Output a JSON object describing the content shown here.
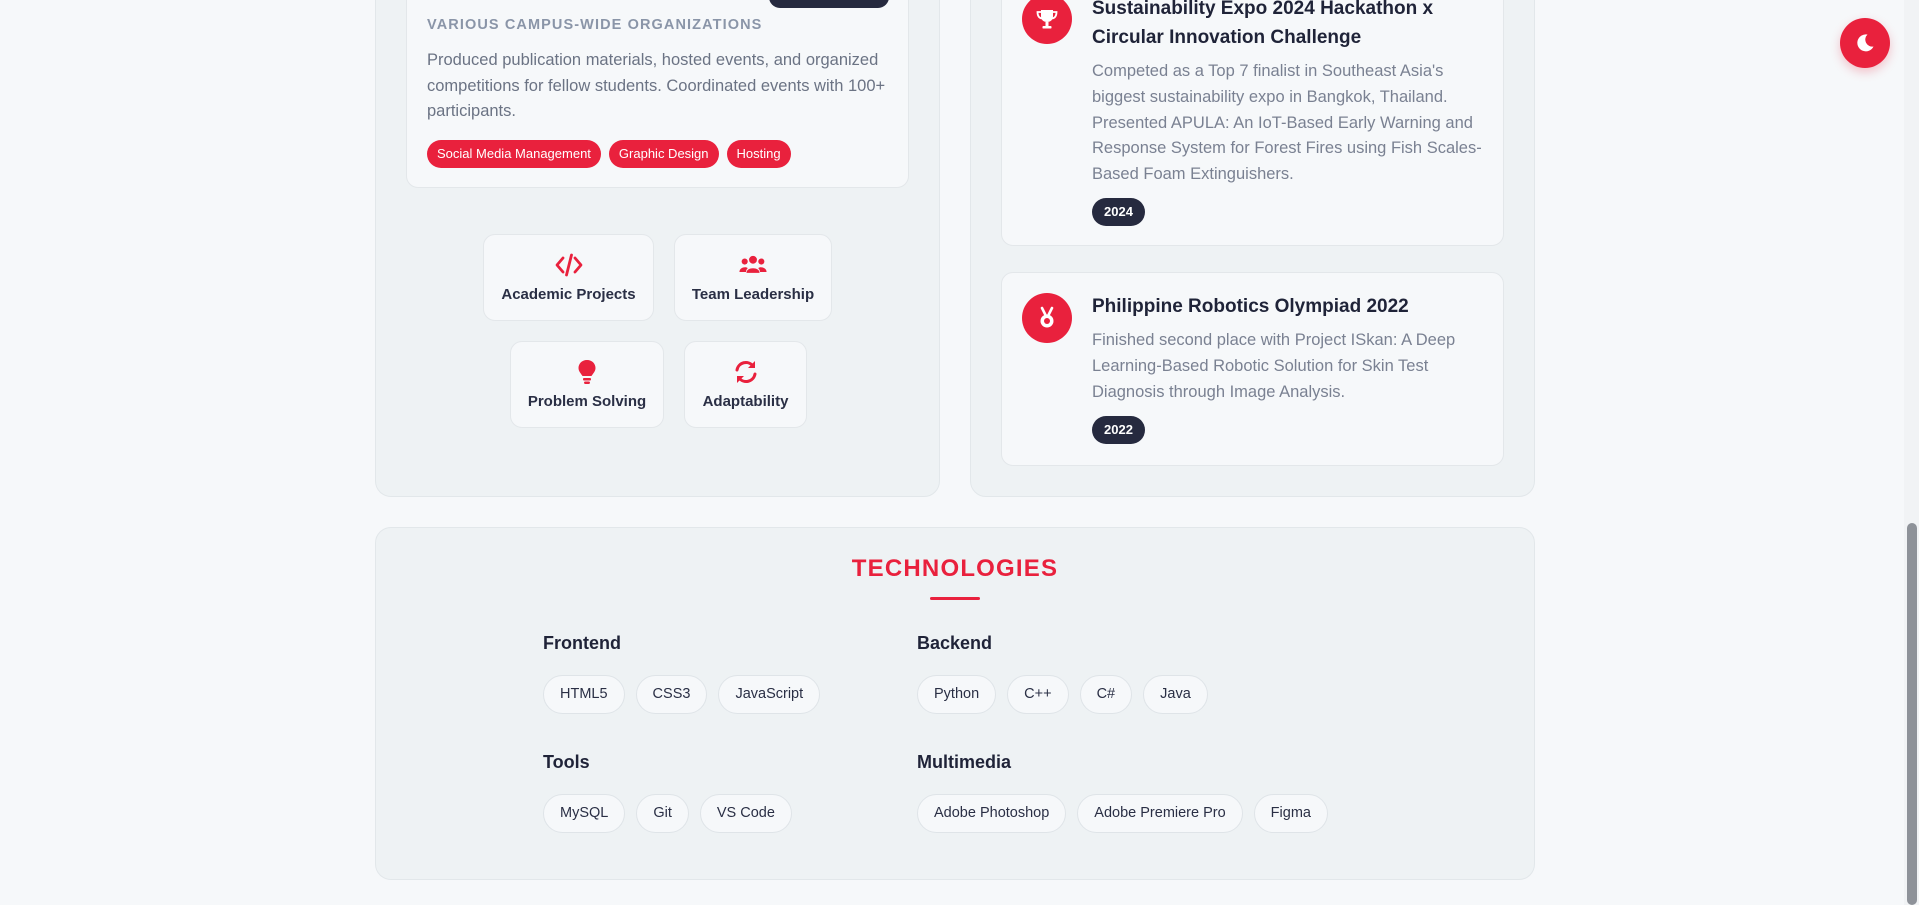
{
  "colors": {
    "accent": "#e9213d",
    "dark_badge": "#262a3f",
    "panel_bg": "#eef2f4"
  },
  "experience": {
    "org": "VARIOUS CAMPUS-WIDE ORGANIZATIONS",
    "description": "Produced publication materials, hosted events, and organized competitions for fellow students. Coordinated events with 100+ participants.",
    "tags": [
      "Social Media Management",
      "Graphic Design",
      "Hosting"
    ]
  },
  "skills": [
    {
      "label": "Academic Projects",
      "icon": "code-icon"
    },
    {
      "label": "Team Leadership",
      "icon": "users-icon"
    },
    {
      "label": "Problem Solving",
      "icon": "lightbulb-icon"
    },
    {
      "label": "Adaptability",
      "icon": "sync-icon"
    }
  ],
  "achievements": [
    {
      "title": "Sustainability Expo 2024 Hackathon x Circular Innovation Challenge",
      "description": "Competed as a Top 7 finalist in Southeast Asia's biggest sustainability expo in Bangkok, Thailand. Presented APULA: An IoT-Based Early Warning and Response System for Forest Fires using Fish Scales-Based Foam Extinguishers.",
      "year": "2024",
      "icon": "trophy-icon"
    },
    {
      "title": "Philippine Robotics Olympiad 2022",
      "description": "Finished second place with Project ISkan: A Deep Learning-Based Robotic Solution for Skin Test Diagnosis through Image Analysis.",
      "year": "2022",
      "icon": "medal-icon"
    }
  ],
  "technologies": {
    "heading": "TECHNOLOGIES",
    "groups": [
      {
        "title": "Frontend",
        "items": [
          "HTML5",
          "CSS3",
          "JavaScript"
        ]
      },
      {
        "title": "Backend",
        "items": [
          "Python",
          "C++",
          "C#",
          "Java"
        ]
      },
      {
        "title": "Tools",
        "items": [
          "MySQL",
          "Git",
          "VS Code"
        ]
      },
      {
        "title": "Multimedia",
        "items": [
          "Adobe Photoshop",
          "Adobe Premiere Pro",
          "Figma"
        ]
      }
    ]
  },
  "theme_toggle": {
    "icon": "moon-icon"
  }
}
